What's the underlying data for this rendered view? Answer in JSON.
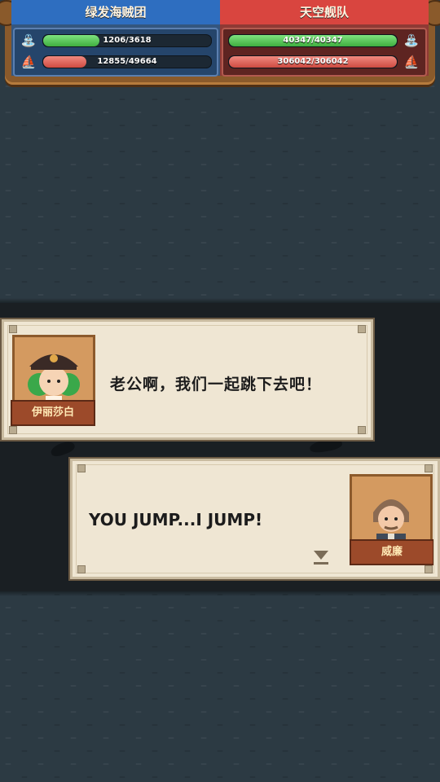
{
  "hud": {
    "left_team": {
      "name": "绿发海贼团",
      "hp_text": "1206/3618",
      "hp_ratio": 0.333,
      "power_text": "12855/49664",
      "power_ratio": 0.259
    },
    "right_team": {
      "name": "天空舰队",
      "hp_text": "40347/40347",
      "hp_ratio": 1.0,
      "power_text": "306042/306042",
      "power_ratio": 1.0
    }
  },
  "dialog_top": {
    "speaker": "伊丽莎白",
    "text": "老公啊，我们一起跳下去吧！"
  },
  "dialog_bottom": {
    "speaker": "威廉",
    "text": "YOU JUMP...I JUMP!"
  },
  "colors": {
    "left_team": "#2e6ec0",
    "right_team": "#d9453f",
    "hp_bar": "#4fc24f",
    "power_bar": "#e0625a",
    "dialog_bg": "#efe6d3"
  },
  "icons": {
    "hp": "water-drop-icon",
    "power": "ship-icon",
    "next": "triangle-down-icon"
  }
}
